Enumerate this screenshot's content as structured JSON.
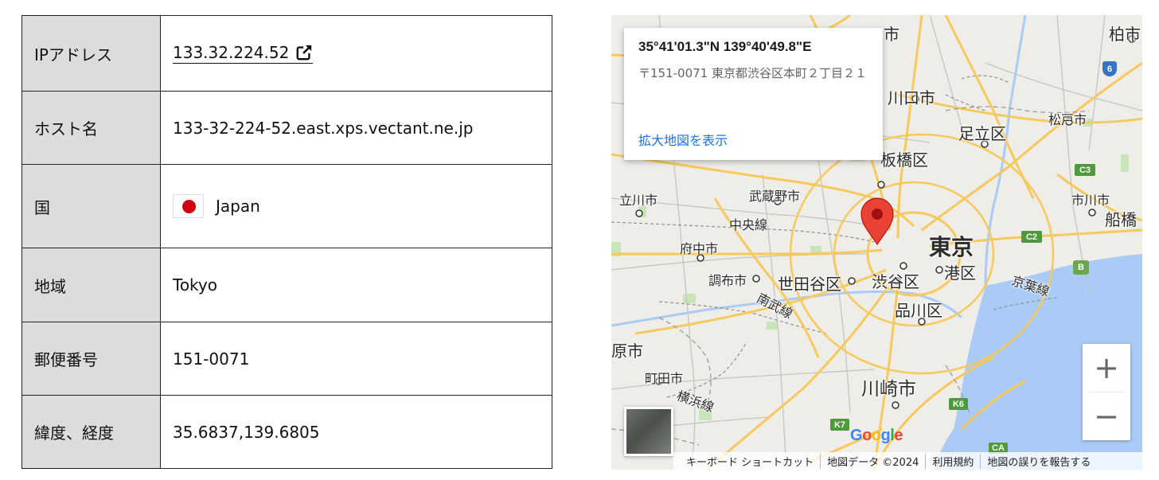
{
  "table": {
    "rows": [
      {
        "key": "IPアドレス",
        "value": "133.32.224.52"
      },
      {
        "key": "ホスト名",
        "value": "133-32-224-52.east.xps.vectant.ne.jp"
      },
      {
        "key": "国",
        "value": "Japan"
      },
      {
        "key": "地域",
        "value": "Tokyo"
      },
      {
        "key": "郵便番号",
        "value": "151-0071"
      },
      {
        "key": "緯度、経度",
        "value": "35.6837,139.6805"
      }
    ]
  },
  "map": {
    "popup": {
      "coordinates": "35°41'01.3\"N 139°40'49.8\"E",
      "address": "〒151-0071 東京都渋谷区本町２丁目２１",
      "link": "拡大地図を表示"
    },
    "labels": {
      "tokyo": "東京",
      "kawaguchi": "川口市",
      "adachi": "足立区",
      "itabashi": "板橋区",
      "musashino": "武蔵野市",
      "tachikawa": "立川市",
      "chuosen": "中央線",
      "fuchu": "府中市",
      "chofu": "調布市",
      "setagaya": "世田谷区",
      "shibuya": "渋谷区",
      "minato": "港区",
      "shinagawa": "品川区",
      "nambu": "南武線",
      "keiyo": "京葉線",
      "kawasaki": "川崎市",
      "machida": "町田市",
      "yokohamasen": "横浜線",
      "harashi": "原市",
      "matsudo": "松戸市",
      "ichikawa": "市川市",
      "funabashi": "船橋",
      "kashiwa": "柏市",
      "top_cut": "市"
    },
    "badges": {
      "b6": "6",
      "c3": "C3",
      "c2": "C2",
      "b": "B",
      "k7": "K7",
      "k6": "K6",
      "ca": "CA"
    },
    "zoom_in": "+",
    "zoom_out": "−",
    "logo_letters": [
      "G",
      "o",
      "o",
      "g",
      "l",
      "e"
    ],
    "footer": {
      "shortcuts": "キーボード ショートカット",
      "data": "地図データ ©2024",
      "terms": "利用規約",
      "report": "地図の誤りを報告する"
    },
    "colors": {
      "water": "#aacbf5",
      "land": "#eeede8",
      "major_road": "#f7c95c",
      "park": "#c7e5b8",
      "marker": "#ea4335"
    }
  }
}
